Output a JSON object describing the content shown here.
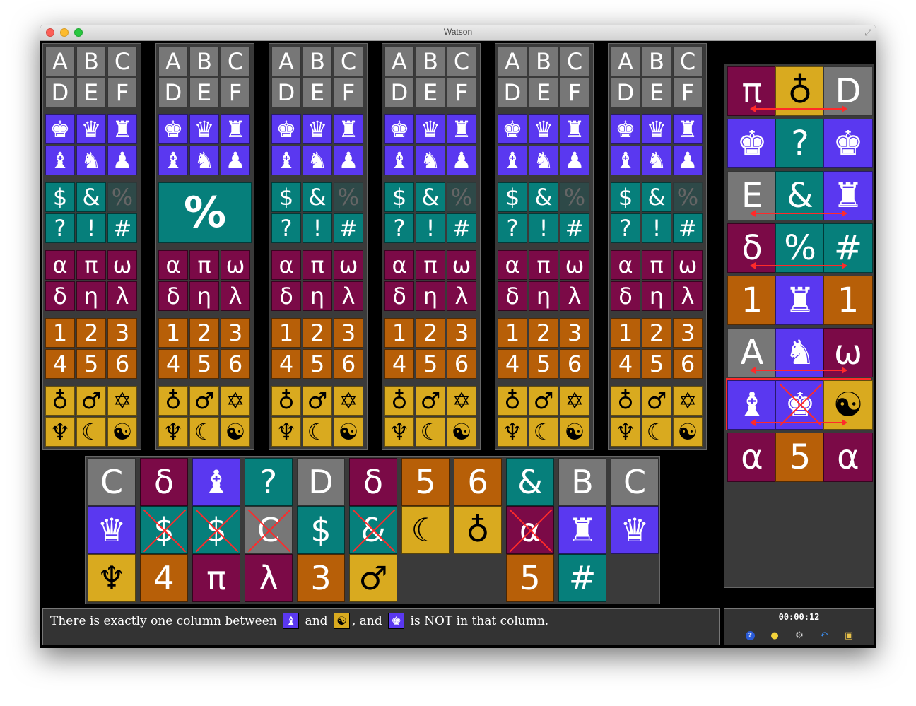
{
  "window": {
    "title": "Watson"
  },
  "colors": {
    "gray": "#777777",
    "blue": "#5a38f0",
    "teal": "#067f7b",
    "maroon": "#7b0a47",
    "orange": "#b75f08",
    "yellow": "#d9aa1f",
    "cross": "#ff2a2a"
  },
  "grid": {
    "columns": [
      {
        "rows": [
          {
            "color": "gray",
            "full": false,
            "cells": [
              "A",
              "B",
              "C",
              "D",
              "E",
              "F"
            ],
            "elim": []
          },
          {
            "color": "blue",
            "full": false,
            "cells": [
              "♚",
              "♛",
              "♜",
              "♝",
              "♞",
              "♟"
            ],
            "elim": []
          },
          {
            "color": "teal",
            "full": false,
            "cells": [
              "$",
              "&",
              "%",
              "?",
              "!",
              "#"
            ],
            "elim": [
              2
            ]
          },
          {
            "color": "maroon",
            "full": false,
            "cells": [
              "α",
              "π",
              "ω",
              "δ",
              "η",
              "λ"
            ],
            "elim": []
          },
          {
            "color": "orange",
            "full": false,
            "cells": [
              "1",
              "2",
              "3",
              "4",
              "5",
              "6"
            ],
            "elim": []
          },
          {
            "color": "yellow",
            "full": false,
            "cells": [
              "♁",
              "♂",
              "✡",
              "♆",
              "☾",
              "☯"
            ],
            "elim": []
          }
        ]
      },
      {
        "rows": [
          {
            "color": "gray",
            "full": false,
            "cells": [
              "A",
              "B",
              "C",
              "D",
              "E",
              "F"
            ],
            "elim": []
          },
          {
            "color": "blue",
            "full": false,
            "cells": [
              "♚",
              "♛",
              "♜",
              "♝",
              "♞",
              "♟"
            ],
            "elim": []
          },
          {
            "color": "teal",
            "full": true,
            "cells": [
              "%"
            ],
            "elim": []
          },
          {
            "color": "maroon",
            "full": false,
            "cells": [
              "α",
              "π",
              "ω",
              "δ",
              "η",
              "λ"
            ],
            "elim": []
          },
          {
            "color": "orange",
            "full": false,
            "cells": [
              "1",
              "2",
              "3",
              "4",
              "5",
              "6"
            ],
            "elim": []
          },
          {
            "color": "yellow",
            "full": false,
            "cells": [
              "♁",
              "♂",
              "✡",
              "♆",
              "☾",
              "☯"
            ],
            "elim": []
          }
        ]
      },
      {
        "rows": [
          {
            "color": "gray",
            "full": false,
            "cells": [
              "A",
              "B",
              "C",
              "D",
              "E",
              "F"
            ],
            "elim": []
          },
          {
            "color": "blue",
            "full": false,
            "cells": [
              "♚",
              "♛",
              "♜",
              "♝",
              "♞",
              "♟"
            ],
            "elim": []
          },
          {
            "color": "teal",
            "full": false,
            "cells": [
              "$",
              "&",
              "%",
              "?",
              "!",
              "#"
            ],
            "elim": [
              2
            ]
          },
          {
            "color": "maroon",
            "full": false,
            "cells": [
              "α",
              "π",
              "ω",
              "δ",
              "η",
              "λ"
            ],
            "elim": []
          },
          {
            "color": "orange",
            "full": false,
            "cells": [
              "1",
              "2",
              "3",
              "4",
              "5",
              "6"
            ],
            "elim": []
          },
          {
            "color": "yellow",
            "full": false,
            "cells": [
              "♁",
              "♂",
              "✡",
              "♆",
              "☾",
              "☯"
            ],
            "elim": []
          }
        ]
      },
      {
        "rows": [
          {
            "color": "gray",
            "full": false,
            "cells": [
              "A",
              "B",
              "C",
              "D",
              "E",
              "F"
            ],
            "elim": []
          },
          {
            "color": "blue",
            "full": false,
            "cells": [
              "♚",
              "♛",
              "♜",
              "♝",
              "♞",
              "♟"
            ],
            "elim": []
          },
          {
            "color": "teal",
            "full": false,
            "cells": [
              "$",
              "&",
              "%",
              "?",
              "!",
              "#"
            ],
            "elim": [
              2
            ]
          },
          {
            "color": "maroon",
            "full": false,
            "cells": [
              "α",
              "π",
              "ω",
              "δ",
              "η",
              "λ"
            ],
            "elim": []
          },
          {
            "color": "orange",
            "full": false,
            "cells": [
              "1",
              "2",
              "3",
              "4",
              "5",
              "6"
            ],
            "elim": []
          },
          {
            "color": "yellow",
            "full": false,
            "cells": [
              "♁",
              "♂",
              "✡",
              "♆",
              "☾",
              "☯"
            ],
            "elim": []
          }
        ]
      },
      {
        "rows": [
          {
            "color": "gray",
            "full": false,
            "cells": [
              "A",
              "B",
              "C",
              "D",
              "E",
              "F"
            ],
            "elim": []
          },
          {
            "color": "blue",
            "full": false,
            "cells": [
              "♚",
              "♛",
              "♜",
              "♝",
              "♞",
              "♟"
            ],
            "elim": []
          },
          {
            "color": "teal",
            "full": false,
            "cells": [
              "$",
              "&",
              "%",
              "?",
              "!",
              "#"
            ],
            "elim": [
              2
            ]
          },
          {
            "color": "maroon",
            "full": false,
            "cells": [
              "α",
              "π",
              "ω",
              "δ",
              "η",
              "λ"
            ],
            "elim": []
          },
          {
            "color": "orange",
            "full": false,
            "cells": [
              "1",
              "2",
              "3",
              "4",
              "5",
              "6"
            ],
            "elim": []
          },
          {
            "color": "yellow",
            "full": false,
            "cells": [
              "♁",
              "♂",
              "✡",
              "♆",
              "☾",
              "☯"
            ],
            "elim": []
          }
        ]
      },
      {
        "rows": [
          {
            "color": "gray",
            "full": false,
            "cells": [
              "A",
              "B",
              "C",
              "D",
              "E",
              "F"
            ],
            "elim": []
          },
          {
            "color": "blue",
            "full": false,
            "cells": [
              "♚",
              "♛",
              "♜",
              "♝",
              "♞",
              "♟"
            ],
            "elim": []
          },
          {
            "color": "teal",
            "full": false,
            "cells": [
              "$",
              "&",
              "%",
              "?",
              "!",
              "#"
            ],
            "elim": [
              2
            ]
          },
          {
            "color": "maroon",
            "full": false,
            "cells": [
              "α",
              "π",
              "ω",
              "δ",
              "η",
              "λ"
            ],
            "elim": []
          },
          {
            "color": "orange",
            "full": false,
            "cells": [
              "1",
              "2",
              "3",
              "4",
              "5",
              "6"
            ],
            "elim": []
          },
          {
            "color": "yellow",
            "full": false,
            "cells": [
              "♁",
              "♂",
              "✡",
              "♆",
              "☾",
              "☯"
            ],
            "elim": []
          }
        ]
      }
    ]
  },
  "vertical_clues": [
    [
      {
        "sym": "C",
        "color": "gray"
      },
      {
        "sym": "♛",
        "color": "blue"
      },
      {
        "sym": "♆",
        "color": "yellow"
      }
    ],
    [
      {
        "sym": "δ",
        "color": "maroon"
      },
      {
        "sym": "$",
        "color": "teal",
        "crossed": true
      },
      {
        "sym": "4",
        "color": "orange"
      }
    ],
    [
      {
        "sym": "♝",
        "color": "blue"
      },
      {
        "sym": "$",
        "color": "teal",
        "crossed": true
      },
      {
        "sym": "π",
        "color": "maroon"
      }
    ],
    [
      {
        "sym": "?",
        "color": "teal"
      },
      {
        "sym": "C",
        "color": "gray",
        "crossed": true
      },
      {
        "sym": "λ",
        "color": "maroon"
      }
    ],
    [
      {
        "sym": "D",
        "color": "gray"
      },
      {
        "sym": "$",
        "color": "teal"
      },
      {
        "sym": "3",
        "color": "orange"
      }
    ],
    [
      {
        "sym": "δ",
        "color": "maroon"
      },
      {
        "sym": "&",
        "color": "teal",
        "crossed": true
      },
      {
        "sym": "♂",
        "color": "yellow"
      }
    ],
    [
      {
        "sym": "5",
        "color": "orange"
      },
      {
        "sym": "☾",
        "color": "yellow"
      }
    ],
    [
      {
        "sym": "6",
        "color": "orange"
      },
      {
        "sym": "♁",
        "color": "yellow"
      }
    ],
    [
      {
        "sym": "&",
        "color": "teal"
      },
      {
        "sym": "α",
        "color": "maroon",
        "crossed": true
      },
      {
        "sym": "5",
        "color": "orange"
      }
    ],
    [
      {
        "sym": "B",
        "color": "gray"
      },
      {
        "sym": "♜",
        "color": "blue"
      },
      {
        "sym": "#",
        "color": "teal"
      }
    ],
    [
      {
        "sym": "C",
        "color": "gray"
      },
      {
        "sym": "♛",
        "color": "blue"
      }
    ]
  ],
  "horizontal_clues": [
    {
      "cells": [
        {
          "sym": "π",
          "color": "maroon"
        },
        {
          "sym": "♁",
          "color": "yellow"
        },
        {
          "sym": "D",
          "color": "gray"
        }
      ],
      "arrow": true
    },
    {
      "cells": [
        {
          "sym": "♚",
          "color": "blue"
        },
        {
          "sym": "?",
          "color": "teal"
        },
        {
          "sym": "♚",
          "color": "blue"
        }
      ],
      "arrow": false
    },
    {
      "cells": [
        {
          "sym": "E",
          "color": "gray"
        },
        {
          "sym": "&",
          "color": "teal"
        },
        {
          "sym": "♜",
          "color": "blue"
        }
      ],
      "arrow": true
    },
    {
      "cells": [
        {
          "sym": "δ",
          "color": "maroon"
        },
        {
          "sym": "%",
          "color": "teal"
        },
        {
          "sym": "#",
          "color": "teal"
        }
      ],
      "arrow": true
    },
    {
      "cells": [
        {
          "sym": "1",
          "color": "orange"
        },
        {
          "sym": "♜",
          "color": "blue"
        },
        {
          "sym": "1",
          "color": "orange"
        }
      ],
      "arrow": false
    },
    {
      "cells": [
        {
          "sym": "A",
          "color": "gray"
        },
        {
          "sym": "♞",
          "color": "blue"
        },
        {
          "sym": "ω",
          "color": "maroon"
        }
      ],
      "arrow": true
    },
    {
      "cells": [
        {
          "sym": "♝",
          "color": "blue"
        },
        {
          "sym": "♚",
          "color": "blue",
          "crossed": true
        },
        {
          "sym": "☯",
          "color": "yellow"
        }
      ],
      "arrow": true,
      "selected": true
    },
    {
      "cells": [
        {
          "sym": "α",
          "color": "maroon"
        },
        {
          "sym": "5",
          "color": "orange"
        },
        {
          "sym": "α",
          "color": "maroon"
        }
      ],
      "arrow": false
    }
  ],
  "clue_text": {
    "part1": "There is exactly one column between ",
    "icon1": "♝",
    "part2": " and ",
    "icon2": "☯",
    "part3": ", and ",
    "icon3": "♚",
    "part4": " is NOT in that column."
  },
  "status": {
    "timer": "00:00:12",
    "tools": [
      "help-icon",
      "hint-icon",
      "settings-icon",
      "undo-icon",
      "window-icon"
    ]
  }
}
